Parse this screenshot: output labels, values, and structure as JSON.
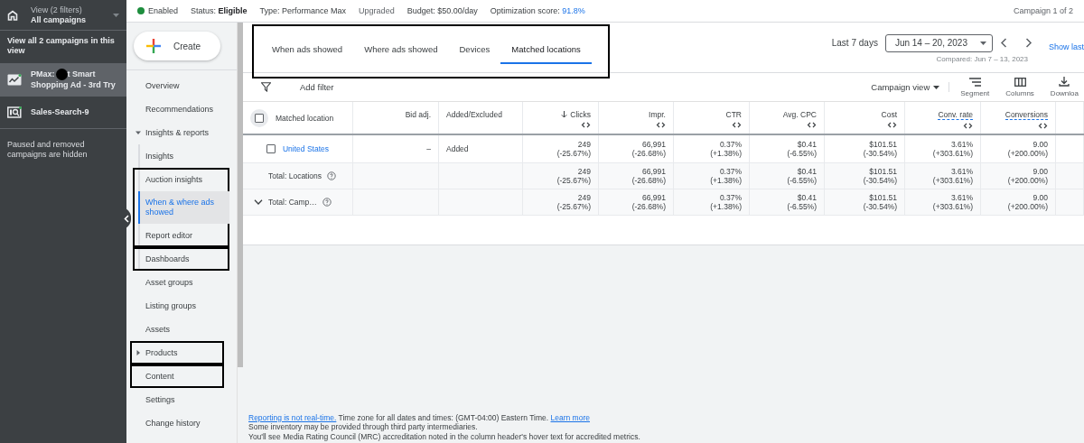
{
  "account_bar": {
    "view_label": "View (2 filters)",
    "view_name": "All campaigns"
  },
  "campaign_list": {
    "header": "View all 2 campaigns in this view",
    "items": [
      {
        "kind": "performance",
        "name_start": "PMax:",
        "name_end": "t Smart",
        "name_more": "Shopping Ad - 3rd Try",
        "redacted": true,
        "selected": true
      },
      {
        "kind": "search",
        "name_start": "Sales-Search-9",
        "redacted": false,
        "selected": false
      }
    ],
    "note": "Paused and removed campaigns are hidden"
  },
  "status_bar": {
    "state": "Enabled",
    "fields": [
      {
        "label": "Status:",
        "value": "Eligible",
        "kind": "emphasis"
      },
      {
        "label": "Type:",
        "value": "Performance Max",
        "kind": "normal"
      },
      {
        "value": "Upgraded",
        "kind": "tag"
      },
      {
        "label": "Budget:",
        "value": "$50.00/day",
        "kind": "normal"
      },
      {
        "label": "Optimization score:",
        "value": "91.8%",
        "kind": "score"
      }
    ],
    "counter": "Campaign 1 of 2"
  },
  "nav": {
    "create_button": "Create",
    "items": [
      {
        "label": "Overview",
        "selected": false
      },
      {
        "label": "Recommendations",
        "selected": false
      },
      {
        "label": "Insights & reports",
        "selected": false,
        "expanded": true,
        "children": [
          {
            "label": "Insights",
            "selected": false
          },
          {
            "label": "Auction insights",
            "selected": false,
            "annotated": true,
            "box_start": true
          },
          {
            "label": "When & where ads showed",
            "selected": true,
            "annotated": true
          },
          {
            "label": "Report editor",
            "selected": false,
            "annotated": true
          },
          {
            "label": "Dashboards",
            "selected": false,
            "annotated": true,
            "box_start": true
          }
        ]
      },
      {
        "label": "Asset groups",
        "selected": false
      },
      {
        "label": "Listing groups",
        "selected": false
      },
      {
        "label": "Assets",
        "selected": false
      },
      {
        "label": "Products",
        "selected": false,
        "expanded": false,
        "annotated": true,
        "box_start": true
      },
      {
        "label": "Content",
        "selected": false,
        "annotated": true,
        "box_start": true
      },
      {
        "label": "Settings",
        "selected": false
      },
      {
        "label": "Change history",
        "selected": false
      }
    ]
  },
  "tabs": {
    "annotated": true,
    "items": [
      {
        "label": "When ads showed",
        "selected": false
      },
      {
        "label": "Where ads showed",
        "selected": false
      },
      {
        "label": "Devices",
        "selected": false
      },
      {
        "label": "Matched locations",
        "selected": true
      }
    ]
  },
  "date_range": {
    "preset": "Last 7 days",
    "range": "Jun 14 – 20, 2023",
    "compared": "Compared: Jun 7 – 13, 2023",
    "link": "Show last"
  },
  "toolbar": {
    "filter": "Add filter",
    "view": "Campaign view",
    "buttons": [
      {
        "kind": "segment",
        "label": "Segment"
      },
      {
        "kind": "columns",
        "label": "Columns"
      },
      {
        "kind": "download",
        "label": "Downloa"
      }
    ]
  },
  "table": {
    "columns": [
      {
        "label": "Matched location",
        "kind": "select",
        "checked": false
      },
      {
        "label": "Bid adj.",
        "kind": "adjustment"
      },
      {
        "label": "Added/Excluded",
        "kind": "text"
      },
      {
        "label": "Clicks",
        "kind": "metric",
        "sorted": true,
        "hint": false
      },
      {
        "label": "Impr.",
        "kind": "metric",
        "sorted": false,
        "hint": false
      },
      {
        "label": "CTR",
        "kind": "metric",
        "sorted": false,
        "hint": false
      },
      {
        "label": "Avg. CPC",
        "kind": "metric",
        "sorted": false,
        "hint": false
      },
      {
        "label": "Cost",
        "kind": "metric",
        "sorted": false,
        "hint": false
      },
      {
        "label": "Conv. rate",
        "kind": "metric",
        "sorted": false,
        "hint": true
      },
      {
        "label": "Conversions",
        "kind": "metric",
        "sorted": false,
        "hint": true
      }
    ],
    "rows": [
      {
        "kind": "location",
        "checked": false,
        "label": "United States",
        "bid_adj": "–",
        "status": "Added",
        "metrics": [
          {
            "value": "249",
            "change": "(-25.67%)"
          },
          {
            "value": "66,991",
            "change": "(-26.68%)"
          },
          {
            "value": "0.37%",
            "change": "(+1.38%)"
          },
          {
            "value": "$0.41",
            "change": "(-6.55%)"
          },
          {
            "value": "$101.51",
            "change": "(-30.54%)"
          },
          {
            "value": "3.61%",
            "change": "(+303.61%)"
          },
          {
            "value": "9.00",
            "change": "(+200.00%)"
          }
        ]
      },
      {
        "kind": "total",
        "label": "Total: Locations",
        "help": true,
        "metrics": [
          {
            "value": "249",
            "change": "(-25.67%)"
          },
          {
            "value": "66,991",
            "change": "(-26.68%)"
          },
          {
            "value": "0.37%",
            "change": "(+1.38%)"
          },
          {
            "value": "$0.41",
            "change": "(-6.55%)"
          },
          {
            "value": "$101.51",
            "change": "(-30.54%)"
          },
          {
            "value": "3.61%",
            "change": "(+303.61%)"
          },
          {
            "value": "9.00",
            "change": "(+200.00%)"
          }
        ]
      },
      {
        "kind": "total",
        "label": "Total: Camp…",
        "help": true,
        "expandable": true,
        "metrics": [
          {
            "value": "249",
            "change": "(-25.67%)"
          },
          {
            "value": "66,991",
            "change": "(-26.68%)"
          },
          {
            "value": "0.37%",
            "change": "(+1.38%)"
          },
          {
            "value": "$0.41",
            "change": "(-6.55%)"
          },
          {
            "value": "$101.51",
            "change": "(-30.54%)"
          },
          {
            "value": "3.61%",
            "change": "(+303.61%)"
          },
          {
            "value": "9.00",
            "change": "(+200.00%)"
          }
        ]
      }
    ]
  },
  "footer": {
    "link": "Reporting is not real-time.",
    "text": "Time zone for all dates and times: (GMT-04:00) Eastern Time.",
    "more_link": "Learn more",
    "lines": [
      "Some inventory may be provided through third party intermediaries.",
      "You'll see Media Rating Council (MRC) accreditation noted in the column header's hover text for accredited metrics."
    ]
  }
}
